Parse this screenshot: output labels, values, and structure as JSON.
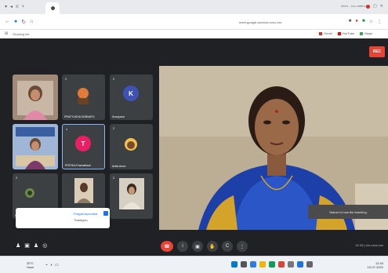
{
  "browser": {
    "tab_title": "Meet - xxx-xxxx-xxx",
    "address_url": "meet.google.com/xxx-xxxx-xxx",
    "bookmarks_left": "Reading list",
    "bookmarks": [
      "Gmail",
      "YouTube",
      "Maps"
    ]
  },
  "meet": {
    "record_label": "REC",
    "caption_text": "Nature is how the teaching",
    "participants": [
      {
        "name": "",
        "number": ""
      },
      {
        "name": "PRATYUSHA DEBNATH",
        "number": "2"
      },
      {
        "name": "Sunayana",
        "number": "2",
        "initial": "K",
        "color": "#3f51b5"
      },
      {
        "name": "",
        "number": ""
      },
      {
        "name": "PRITIKA Khandelwal",
        "number": "2",
        "initial": "T",
        "color": "#e91e63"
      },
      {
        "name": "Anita Arora",
        "number": "2"
      },
      {
        "name": "Ketil mohanty",
        "number": "2"
      },
      {
        "name": "",
        "number": ""
      },
      {
        "name": "",
        "number": "2"
      }
    ],
    "chat_popup": {
      "sender": "Pragati Ayomitha",
      "message": "Thankyou"
    },
    "meeting_info": "12:34 | xxx-xxxx-xxx",
    "controls": [
      "mic",
      "camera",
      "captions",
      "raise-hand",
      "present",
      "more"
    ]
  },
  "taskbar": {
    "weather_temp": "30°C",
    "weather_desc": "Haze",
    "time": "12:34",
    "date": "15-07-2022"
  }
}
